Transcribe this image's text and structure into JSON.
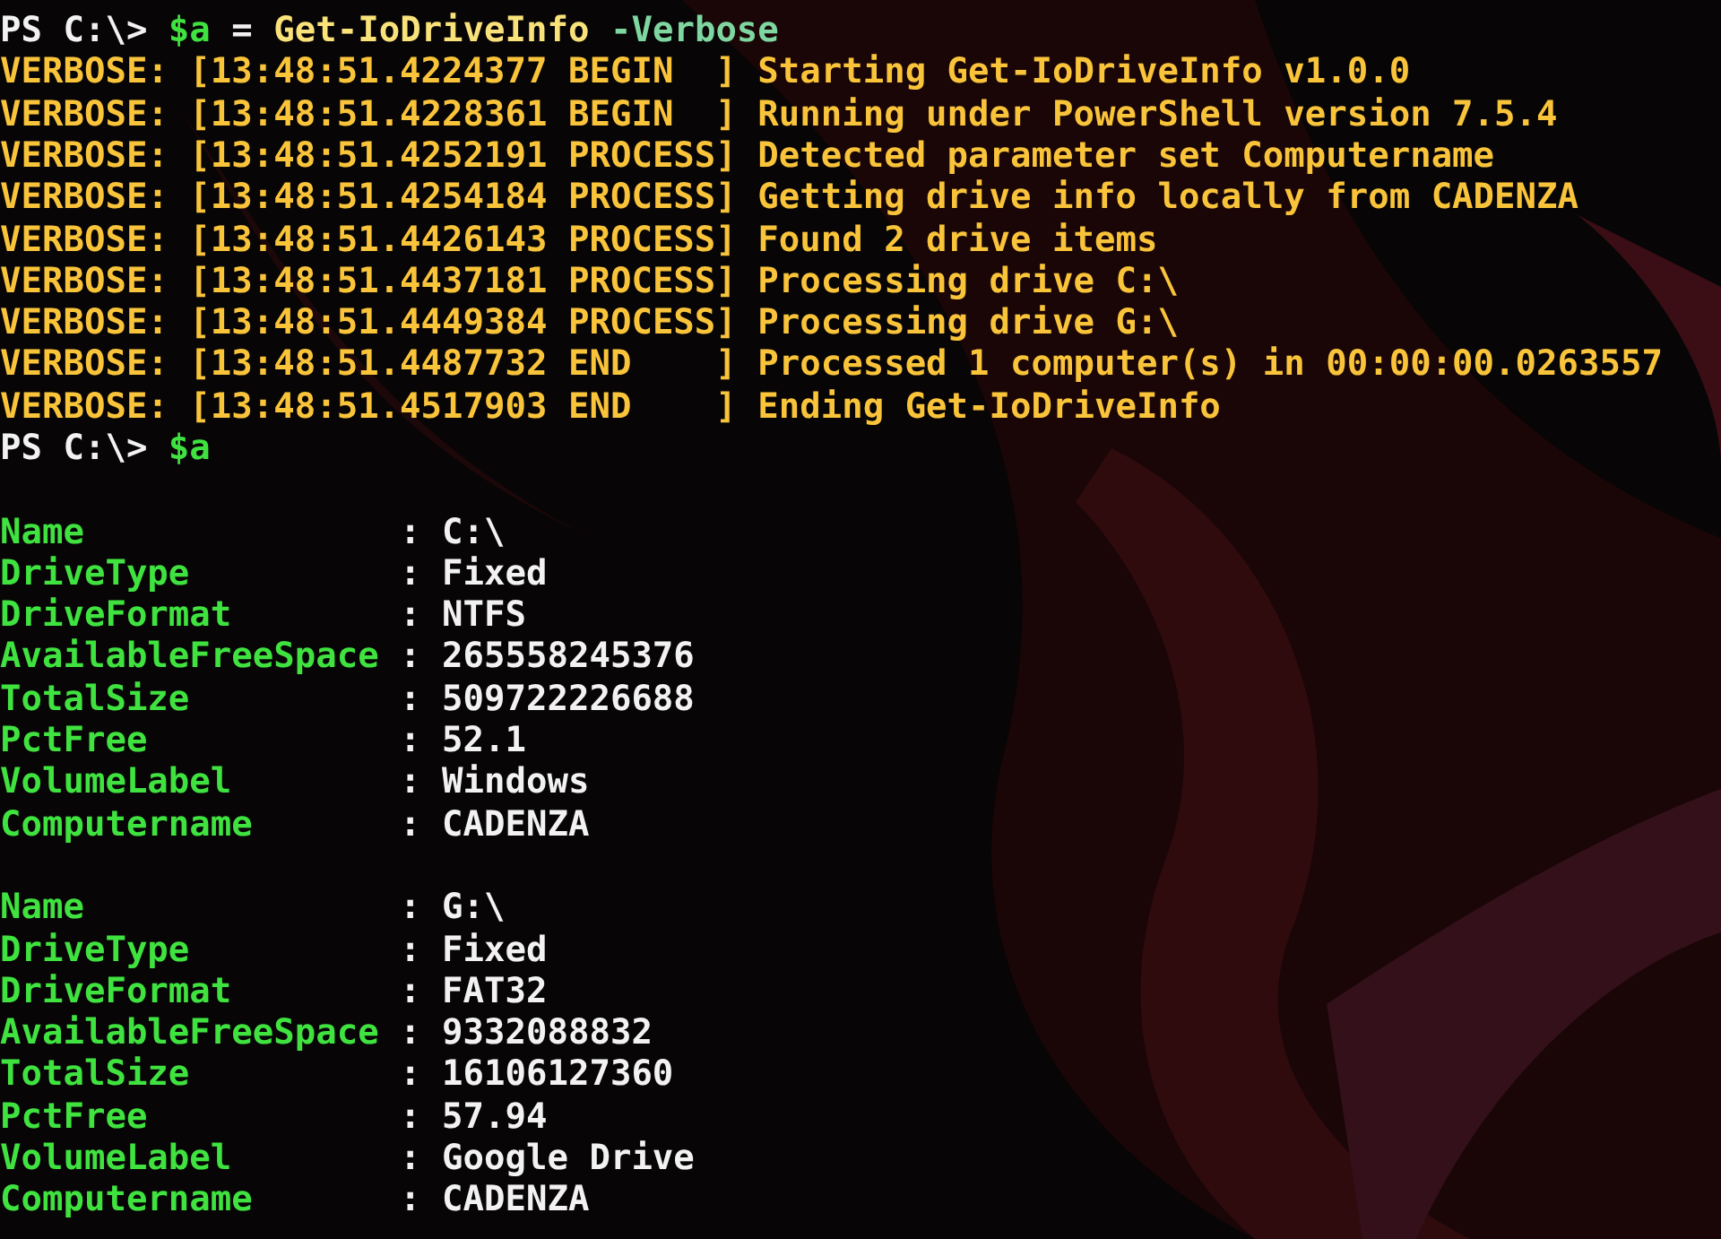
{
  "terminal": {
    "lines": [
      {
        "kind": "prompt",
        "tokens": [
          {
            "kind": "prompt",
            "text": "PS C:\\> "
          },
          {
            "kind": "variable",
            "text": "$a"
          },
          {
            "kind": "operator",
            "text": " = "
          },
          {
            "kind": "command",
            "text": "Get-IoDriveInfo"
          },
          {
            "kind": "parameter",
            "text": " -Verbose"
          }
        ]
      },
      {
        "kind": "verbose",
        "text": "VERBOSE: [13:48:51.4224377 BEGIN  ] Starting Get-IoDriveInfo v1.0.0"
      },
      {
        "kind": "verbose",
        "text": "VERBOSE: [13:48:51.4228361 BEGIN  ] Running under PowerShell version 7.5.4"
      },
      {
        "kind": "verbose",
        "text": "VERBOSE: [13:48:51.4252191 PROCESS] Detected parameter set Computername"
      },
      {
        "kind": "verbose",
        "text": "VERBOSE: [13:48:51.4254184 PROCESS] Getting drive info locally from CADENZA"
      },
      {
        "kind": "verbose",
        "text": "VERBOSE: [13:48:51.4426143 PROCESS] Found 2 drive items"
      },
      {
        "kind": "verbose",
        "text": "VERBOSE: [13:48:51.4437181 PROCESS] Processing drive C:\\"
      },
      {
        "kind": "verbose",
        "text": "VERBOSE: [13:48:51.4449384 PROCESS] Processing drive G:\\"
      },
      {
        "kind": "verbose",
        "text": "VERBOSE: [13:48:51.4487732 END    ] Processed 1 computer(s) in 00:00:00.0263557"
      },
      {
        "kind": "verbose",
        "text": "VERBOSE: [13:48:51.4517903 END    ] Ending Get-IoDriveInfo"
      },
      {
        "kind": "prompt",
        "tokens": [
          {
            "kind": "prompt",
            "text": "PS C:\\> "
          },
          {
            "kind": "variable",
            "text": "$a"
          }
        ]
      },
      {
        "kind": "blank"
      },
      {
        "kind": "property",
        "name": "Name",
        "separator": ":",
        "value": "C:\\"
      },
      {
        "kind": "property",
        "name": "DriveType",
        "separator": ":",
        "value": "Fixed"
      },
      {
        "kind": "property",
        "name": "DriveFormat",
        "separator": ":",
        "value": "NTFS"
      },
      {
        "kind": "property",
        "name": "AvailableFreeSpace",
        "separator": ":",
        "value": "265558245376"
      },
      {
        "kind": "property",
        "name": "TotalSize",
        "separator": ":",
        "value": "509722226688"
      },
      {
        "kind": "property",
        "name": "PctFree",
        "separator": ":",
        "value": "52.1"
      },
      {
        "kind": "property",
        "name": "VolumeLabel",
        "separator": ":",
        "value": "Windows"
      },
      {
        "kind": "property",
        "name": "Computername",
        "separator": ":",
        "value": "CADENZA"
      },
      {
        "kind": "blank"
      },
      {
        "kind": "property",
        "name": "Name",
        "separator": ":",
        "value": "G:\\"
      },
      {
        "kind": "property",
        "name": "DriveType",
        "separator": ":",
        "value": "Fixed"
      },
      {
        "kind": "property",
        "name": "DriveFormat",
        "separator": ":",
        "value": "FAT32"
      },
      {
        "kind": "property",
        "name": "AvailableFreeSpace",
        "separator": ":",
        "value": "9332088832"
      },
      {
        "kind": "property",
        "name": "TotalSize",
        "separator": ":",
        "value": "16106127360"
      },
      {
        "kind": "property",
        "name": "PctFree",
        "separator": ":",
        "value": "57.94"
      },
      {
        "kind": "property",
        "name": "VolumeLabel",
        "separator": ":",
        "value": "Google Drive"
      },
      {
        "kind": "property",
        "name": "Computername",
        "separator": ":",
        "value": "CADENZA"
      }
    ]
  }
}
